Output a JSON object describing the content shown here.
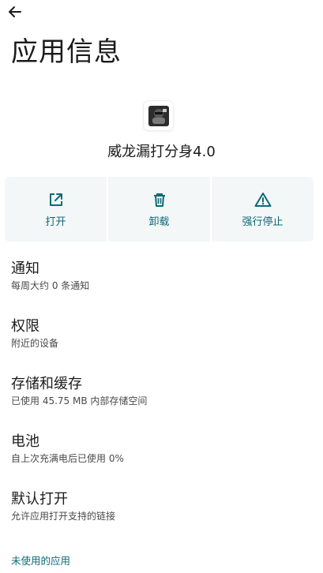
{
  "header": {
    "title": "应用信息",
    "back_icon": "arrow-back-icon"
  },
  "app": {
    "name": "威龙漏打分身4.0",
    "icon": "app-icon"
  },
  "actions": [
    {
      "label": "打开",
      "icon": "open-external-icon"
    },
    {
      "label": "卸载",
      "icon": "trash-icon"
    },
    {
      "label": "强行停止",
      "icon": "warning-triangle-icon"
    }
  ],
  "settings": [
    {
      "title": "通知",
      "subtitle": "每周大约 0 条通知"
    },
    {
      "title": "权限",
      "subtitle": "附近的设备"
    },
    {
      "title": "存储和缓存",
      "subtitle": "已使用 45.75 MB 内部存储空间"
    },
    {
      "title": "电池",
      "subtitle": "自上次充满电后已使用 0%"
    },
    {
      "title": "默认打开",
      "subtitle": "允许应用打开支持的链接"
    }
  ],
  "section_link": "未使用的应用",
  "colors": {
    "accent": "#0b6a78",
    "action_bg": "#f4f7f7",
    "text": "#1b1b1b"
  }
}
